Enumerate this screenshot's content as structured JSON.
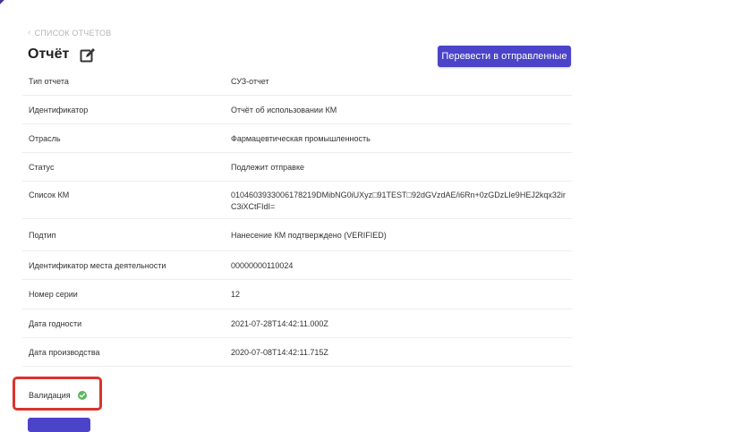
{
  "breadcrumb": {
    "chevron": "‹",
    "label": "СПИСОК ОТЧЕТОВ"
  },
  "page": {
    "title": "Отчёт"
  },
  "actions": {
    "send_label": "Перевести в отправленные"
  },
  "colors": {
    "primary": "#4b43c8",
    "highlight": "#d9342b",
    "success": "#5cb85c"
  },
  "fields": [
    {
      "label": "Тип отчета",
      "value": "СУЗ-отчет"
    },
    {
      "label": "Идентификатор",
      "value": "Отчёт об использовании КМ"
    },
    {
      "label": "Отрасль",
      "value": "Фармацевтическая промышленность"
    },
    {
      "label": "Статус",
      "value": "Подлежит отправке"
    },
    {
      "label": "Список КМ",
      "value": "0104603933006178219DMibNG0iUXyz□91TEST□92dGVzdAE/i6Rn+0zGDzLIe9HEJ2kqx32irC3iXCtFIdI="
    },
    {
      "label": "Подтип",
      "value": "Нанесение КМ подтверждено (VERIFIED)"
    },
    {
      "label": "Идентификатор места деятельности",
      "value": "00000000110024"
    },
    {
      "label": "Номер серии",
      "value": "12"
    },
    {
      "label": "Дата годности",
      "value": "2021-07-28T14:42:11.000Z"
    },
    {
      "label": "Дата производства",
      "value": "2020-07-08T14:42:11.715Z"
    }
  ],
  "validation": {
    "label": "Валидация",
    "status_icon": "check-circle-icon"
  }
}
